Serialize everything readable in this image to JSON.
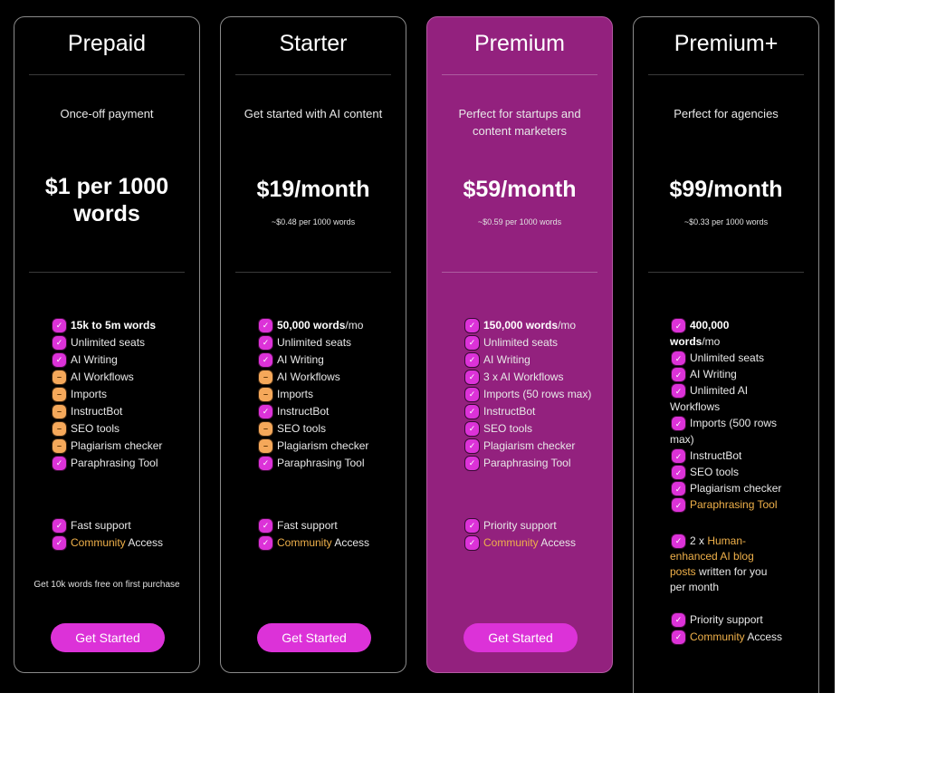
{
  "colors": {
    "accent": "#dc32d8",
    "featured_bg": "#93217e",
    "highlight": "#f0b14a",
    "unavailable": "#f5a85a",
    "page_bg": "#000000"
  },
  "icons": {
    "check": "✓",
    "dash": "–"
  },
  "plans": [
    {
      "name": "Prepaid",
      "subtitle": "Once-off payment",
      "price": "$1 per 1000 words",
      "per_words": "",
      "features": [
        {
          "bold": "15k to 5m words",
          "text": "",
          "icon": "check"
        },
        {
          "text": "Unlimited seats",
          "icon": "check"
        },
        {
          "text": "AI Writing",
          "icon": "check"
        },
        {
          "text": "AI Workflows",
          "icon": "dash"
        },
        {
          "text": "Imports",
          "icon": "dash"
        },
        {
          "text": "InstructBot",
          "icon": "dash"
        },
        {
          "text": "SEO tools",
          "icon": "dash"
        },
        {
          "text": "Plagiarism checker",
          "icon": "dash"
        },
        {
          "text": "Paraphrasing Tool",
          "icon": "check"
        }
      ],
      "support": [
        {
          "text": "Fast support",
          "icon": "check"
        },
        {
          "highlight": "Community",
          "text": " Access",
          "icon": "check"
        }
      ],
      "note": "Get 10k words free on first purchase",
      "cta": "Get Started"
    },
    {
      "name": "Starter",
      "subtitle": "Get started with AI content",
      "price": "$19/month",
      "per_words": "~$0.48 per 1000 words",
      "features": [
        {
          "bold": "50,000 words",
          "text": "/mo",
          "icon": "check"
        },
        {
          "text": "Unlimited seats",
          "icon": "check"
        },
        {
          "text": "AI Writing",
          "icon": "check"
        },
        {
          "text": "AI Workflows",
          "icon": "dash"
        },
        {
          "text": "Imports",
          "icon": "dash"
        },
        {
          "text": "InstructBot",
          "icon": "check"
        },
        {
          "text": "SEO tools",
          "icon": "dash"
        },
        {
          "text": "Plagiarism checker",
          "icon": "dash"
        },
        {
          "text": "Paraphrasing Tool",
          "icon": "check"
        }
      ],
      "support": [
        {
          "text": "Fast support",
          "icon": "check"
        },
        {
          "highlight": "Community",
          "text": " Access",
          "icon": "check"
        }
      ],
      "cta": "Get Started"
    },
    {
      "name": "Premium",
      "subtitle": "Perfect for startups and content marketers",
      "price": "$59/month",
      "per_words": "~$0.59 per 1000 words",
      "features": [
        {
          "bold": "150,000 words",
          "text": "/mo",
          "icon": "check"
        },
        {
          "text": "Unlimited seats",
          "icon": "check"
        },
        {
          "text": "AI Writing",
          "icon": "check"
        },
        {
          "text": "3 x AI Workflows",
          "icon": "check"
        },
        {
          "text": "Imports (50 rows max)",
          "icon": "check"
        },
        {
          "text": "InstructBot",
          "icon": "check"
        },
        {
          "text": "SEO tools",
          "icon": "check"
        },
        {
          "text": "Plagiarism checker",
          "icon": "check"
        },
        {
          "text": "Paraphrasing Tool",
          "icon": "check"
        }
      ],
      "support": [
        {
          "text": "Priority support",
          "icon": "check"
        },
        {
          "highlight": "Community",
          "text": " Access",
          "icon": "check"
        }
      ],
      "cta": "Get Started"
    },
    {
      "name": "Premium+",
      "subtitle": "Perfect for agencies",
      "price": "$99/month",
      "per_words": "~$0.33 per 1000 words",
      "features": [
        {
          "bold": "400,000 words",
          "text": "/mo",
          "icon": "check"
        },
        {
          "text": "Unlimited seats",
          "icon": "check"
        },
        {
          "text": "AI Writing",
          "icon": "check"
        },
        {
          "text": "Unlimited AI Workflows",
          "icon": "check"
        },
        {
          "text": "Imports (500 rows max)",
          "icon": "check"
        },
        {
          "text": "InstructBot",
          "icon": "check"
        },
        {
          "text": "SEO tools",
          "icon": "check"
        },
        {
          "text": "Plagiarism checker",
          "icon": "check"
        },
        {
          "highlight": "Paraphrasing Tool",
          "text": "",
          "icon": "check"
        }
      ],
      "extra": {
        "prefix": "2 x ",
        "highlight": "Human-enhanced AI blog posts",
        "suffix": " written for you per month",
        "icon": "check"
      },
      "support": [
        {
          "text": "Priority support",
          "icon": "check"
        },
        {
          "highlight": "Community",
          "text": " Access",
          "icon": "check"
        }
      ]
    }
  ]
}
